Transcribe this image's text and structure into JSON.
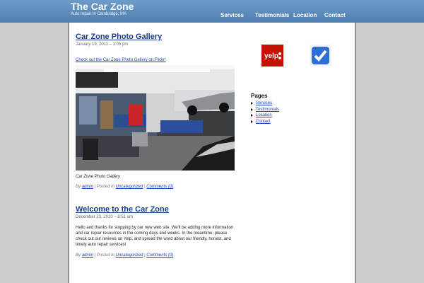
{
  "site": {
    "title": "The Car Zone",
    "tagline": "Auto repair in Cambridge, MA"
  },
  "nav": [
    {
      "label": "Services"
    },
    {
      "label": "Testimonials"
    },
    {
      "label": "Location"
    },
    {
      "label": "Contact"
    }
  ],
  "posts": [
    {
      "title": "Car Zone Photo Gallery",
      "date": "January 19, 2011 – 1:05 pm",
      "link_text": "Check out the Car Zone Photo Gallery on Flickr!",
      "caption": "Car Zone Photo Gallery",
      "meta": {
        "by": "By",
        "author": "admin",
        "posted_in": "| Posted in",
        "category": "Uncategorized",
        "sep": "|",
        "comments": "Comments (0)"
      }
    },
    {
      "title": "Welcome to the Car Zone",
      "date": "December 23, 2010 – 8:51 am",
      "body": "Hello and thanks for stopping by our new web site. We'll be adding more information and car repair resources in the coming days and weeks. In the meantime, please check out our reviews on Yelp, and spread the word about our friendly, honest, and timely auto repair services!",
      "meta": {
        "by": "By",
        "author": "admin",
        "posted_in": "| Posted in",
        "category": "Uncategorized",
        "sep": "|",
        "comments": "Comments (0)"
      }
    }
  ],
  "sidebar": {
    "yelp_logo": "yelp",
    "foursquare_icon": "foursquare-check-icon",
    "pages_title": "Pages",
    "pages": [
      {
        "label": "Services"
      },
      {
        "label": "Testimonials"
      },
      {
        "label": "Location"
      },
      {
        "label": "Contact"
      }
    ]
  },
  "colors": {
    "header": "#5b88b8",
    "link": "#1a3fbf",
    "title": "#1b3b8a",
    "yelp": "#c41200",
    "foursquare": "#2d6fd6"
  }
}
